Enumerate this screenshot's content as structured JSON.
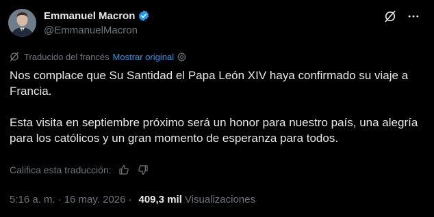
{
  "author": {
    "name": "Emmanuel Macron",
    "handle": "@EmmanuelMacron",
    "verified_badge_color": "#1d9bf0",
    "avatar_icon": "profile-photo"
  },
  "header_actions": {
    "grok_icon": "grok-icon",
    "more_icon": "more-icon"
  },
  "translation": {
    "label": "Traducido del francés",
    "show_original": "Mostrar original",
    "gear_icon": "gear-icon"
  },
  "post": {
    "paragraphs": [
      "Nos complace que Su Santidad el Papa León XIV haya confirmado su viaje a Francia.",
      "Esta visita en septiembre próximo será un honor para nuestro país, una alegría para los católicos y un gran momento de esperanza para todos."
    ]
  },
  "rating": {
    "label": "Califica esta traducción:",
    "thumbs_up_icon": "thumbs-up-icon",
    "thumbs_down_icon": "thumbs-down-icon"
  },
  "meta": {
    "time": "5:16 a. m.",
    "separator": "·",
    "date": "16 may. 2026",
    "separator2": "·",
    "views_count": "409,3 mil",
    "views_label": "Visualizaciones"
  },
  "colors": {
    "background": "#000000",
    "text_primary": "#e7e9ea",
    "text_secondary": "#71767b",
    "link": "#1d9bf0"
  }
}
